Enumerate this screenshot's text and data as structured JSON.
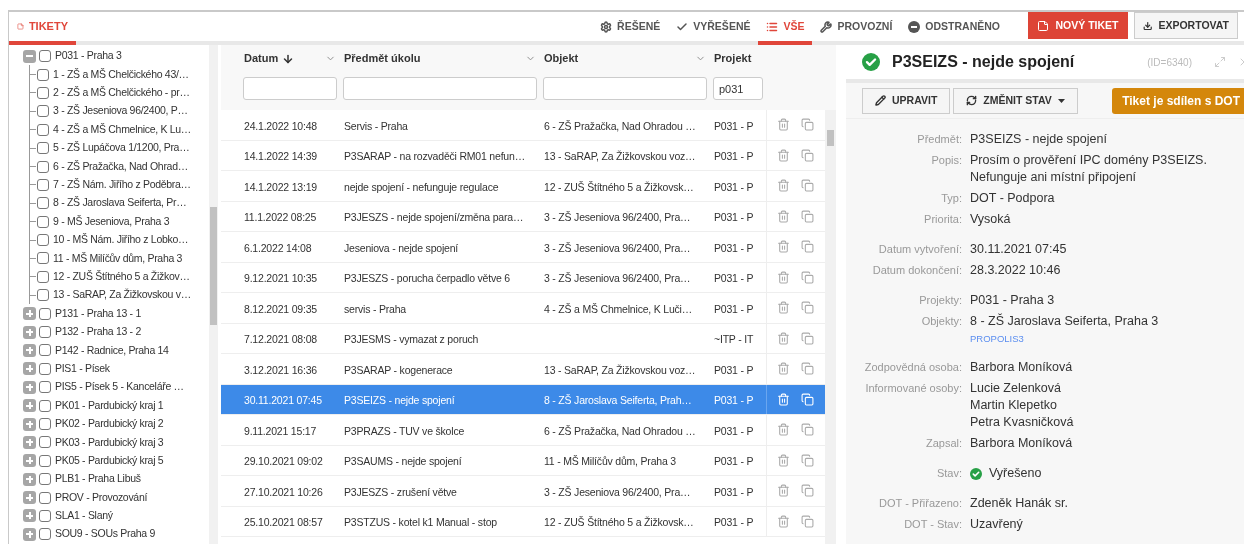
{
  "header": {
    "tab": {
      "label": "TIKETY",
      "selected": true
    },
    "filters": [
      {
        "label": "ŘEŠENÉ",
        "selected": false
      },
      {
        "label": "VYŘEŠENÉ",
        "selected": false
      },
      {
        "label": "VŠE",
        "selected": true
      },
      {
        "label": "PROVOZNÍ",
        "selected": false
      },
      {
        "label": "ODSTRANĚNO",
        "selected": false
      }
    ],
    "buttons": [
      {
        "label": "NOVÝ TIKET",
        "kind": "primary"
      },
      {
        "label": "EXPORTOVAT",
        "kind": "export"
      }
    ]
  },
  "tree": [
    {
      "label": "P031 - Praha 3",
      "expanded": true,
      "checked": false,
      "children": [
        {
          "label": "1 - ZŠ a MŠ Chelčického 43/…",
          "checked": false
        },
        {
          "label": "2 - ZŠ a MŠ Chelčického - pr…",
          "checked": false
        },
        {
          "label": "3 - ZŠ Jeseniova 96/2400, P…",
          "checked": false
        },
        {
          "label": "4 - ZŠ a MŠ Chmelnice, K Lu…",
          "checked": false
        },
        {
          "label": "5 - ZŠ Lupáčova 1/1200, Pra…",
          "checked": false
        },
        {
          "label": "6 - ZŠ Pražačka, Nad Ohrad…",
          "checked": false
        },
        {
          "label": "7 - ZŠ Nám. Jiřího z Poděbra…",
          "checked": false
        },
        {
          "label": "8 - ZŠ Jaroslava Seiferta, Pr…",
          "checked": false
        },
        {
          "label": "9 - MŠ Jeseniova, Praha 3",
          "checked": false
        },
        {
          "label": "10 - MŠ Nám. Jiřího z Lobko…",
          "checked": false
        },
        {
          "label": "11 - MŠ Milíčův dům, Praha 3",
          "checked": false
        },
        {
          "label": "12 - ZUŠ Štítného 5 a Žižkov…",
          "checked": false
        },
        {
          "label": "13 - SaRAP, Za Žižkovskou v…",
          "checked": false
        }
      ]
    },
    {
      "label": "P131 - Praha 13 - 1",
      "expanded": false,
      "checked": false
    },
    {
      "label": "P132 - Praha 13 - 2",
      "expanded": false,
      "checked": false
    },
    {
      "label": "P142 - Radnice, Praha 14",
      "expanded": false,
      "checked": false
    },
    {
      "label": "PIS1 - Písek",
      "expanded": false,
      "checked": false
    },
    {
      "label": "PIS5 - Písek 5 - Kanceláře …",
      "expanded": false,
      "checked": false
    },
    {
      "label": "PK01 - Pardubický kraj 1",
      "expanded": false,
      "checked": false
    },
    {
      "label": "PK02 - Pardubický kraj 2",
      "expanded": false,
      "checked": false
    },
    {
      "label": "PK03 - Pardubický kraj 3",
      "expanded": false,
      "checked": false
    },
    {
      "label": "PK05 - Pardubický kraj 5",
      "expanded": false,
      "checked": false
    },
    {
      "label": "PLB1 - Praha Libuš",
      "expanded": false,
      "checked": false
    },
    {
      "label": "PROV - Provozování",
      "expanded": false,
      "checked": false
    },
    {
      "label": "SLA1 - Slaný",
      "expanded": false,
      "checked": false
    },
    {
      "label": "SOU9 - SOUs Praha 9",
      "expanded": false,
      "checked": false
    }
  ],
  "table": {
    "columns": [
      {
        "label": "Datum",
        "sorted": true
      },
      {
        "label": "Předmět úkolu",
        "sorted": false
      },
      {
        "label": "Objekt",
        "sorted": false
      },
      {
        "label": "Projekt",
        "sorted": false,
        "filter_value": "p031"
      }
    ],
    "rows": [
      {
        "cells": [
          "24.1.2022 10:48",
          "Servis - Praha",
          "6 - ZŠ Pražačka, Nad Ohradou …",
          "P031 - P"
        ],
        "selected": false
      },
      {
        "cells": [
          "14.1.2022 14:39",
          "P3SARAP - na rozvaděči RM01 nefun…",
          "13 - SaRAP, Za Žižkovskou voz…",
          "P031 - P"
        ],
        "selected": false
      },
      {
        "cells": [
          "14.1.2022 13:19",
          "nejde spojení - nefunguje regulace",
          "12 - ZUŠ Štítného 5 a Žižkovsk…",
          "P031 - P"
        ],
        "selected": false
      },
      {
        "cells": [
          "11.1.2022 08:25",
          "P3JESZS - nejde spojení/změna para…",
          "3 - ZŠ Jeseniova 96/2400, Pra…",
          "P031 - P"
        ],
        "selected": false
      },
      {
        "cells": [
          "6.1.2022 14:08",
          "Jeseniova - nejde spojení",
          "3 - ZŠ Jeseniova 96/2400, Pra…",
          "P031 - P"
        ],
        "selected": false
      },
      {
        "cells": [
          "9.12.2021 10:35",
          "P3JESZS - porucha čerpadlo větve 6",
          "3 - ZŠ Jeseniova 96/2400, Pra…",
          "P031 - P"
        ],
        "selected": false
      },
      {
        "cells": [
          "8.12.2021 09:35",
          "servis - Praha",
          "4 - ZŠ a MŠ Chmelnice, K Luči…",
          "P031 - P"
        ],
        "selected": false
      },
      {
        "cells": [
          "7.12.2021 08:08",
          "P3JESMS - vymazat z poruch",
          "",
          "~ITP - IT"
        ],
        "selected": false
      },
      {
        "cells": [
          "3.12.2021 16:36",
          "P3SARAP - kogenerace",
          "13 - SaRAP, Za Žižkovskou voz…",
          "P031 - P"
        ],
        "selected": false
      },
      {
        "cells": [
          "30.11.2021 07:45",
          "P3SEIZS - nejde spojení",
          "8 - ZŠ Jaroslava Seiferta, Prah…",
          "P031 - P"
        ],
        "selected": true
      },
      {
        "cells": [
          "9.11.2021 15:17",
          "P3PRAZS - TUV ve školce",
          "6 - ZŠ Pražačka, Nad Ohradou …",
          "P031 - P"
        ],
        "selected": false
      },
      {
        "cells": [
          "29.10.2021 09:02",
          "P3SAUMS - nejde spojení",
          "11 - MŠ Milíčův dům, Praha 3",
          "P031 - P"
        ],
        "selected": false
      },
      {
        "cells": [
          "27.10.2021 10:26",
          "P3JESZS - zrušení větve",
          "3 - ZŠ Jeseniova 96/2400, Pra…",
          "P031 - P"
        ],
        "selected": false
      },
      {
        "cells": [
          "25.10.2021 08:57",
          "P3STZUS - kotel k1 Manual - stop",
          "12 - ZUŠ Štítného 5 a Žižkovsk…",
          "P031 - P"
        ],
        "selected": false
      }
    ]
  },
  "detail": {
    "title": "P3SEIZS - nejde spojení",
    "resolved": true,
    "id": "(ID=6340)",
    "buttons": [
      {
        "label": "UPRAVIT",
        "kind": "edit"
      },
      {
        "label": "ZMĚNIT STAV",
        "kind": "dropdown"
      }
    ],
    "badge": "Tiket je sdílen s DOT",
    "groups": [
      [
        {
          "label": "Předmět:",
          "values": [
            "P3SEIZS - nejde spojení"
          ]
        },
        {
          "label": "Popis:",
          "values": [
            "Prosím o prověření IPC domény P3SEIZS. Nefunguje ani místní připojení"
          ]
        },
        {
          "label": "Typ:",
          "values": [
            "DOT - Podpora"
          ]
        },
        {
          "label": "Priorita:",
          "values": [
            "Vysoká"
          ]
        }
      ],
      [
        {
          "label": "Datum vytvoření:",
          "values": [
            "30.11.2021 07:45"
          ]
        },
        {
          "label": "Datum dokončení:",
          "values": [
            "28.3.2022 10:46"
          ]
        }
      ],
      [
        {
          "label": "Projekty:",
          "values": [
            "P031 - Praha 3"
          ]
        },
        {
          "label": "Objekty:",
          "values": [
            "8 - ZŠ Jaroslava Seiferta, Praha 3"
          ],
          "link": "PROPOLIS3"
        }
      ],
      [
        {
          "label": "Zodpovědná osoba:",
          "values": [
            "Barbora Moníková"
          ]
        },
        {
          "label": "Informované osoby:",
          "values": [
            "Lucie Zelenková",
            "Martin Klepetko",
            "Petra Kvasničková"
          ]
        },
        {
          "label": "Zapsal:",
          "values": [
            "Barbora Moníková"
          ]
        }
      ],
      [
        {
          "label": "Stav:",
          "values": [
            "Vyřešeno"
          ],
          "kind": "status"
        }
      ],
      [
        {
          "label": "DOT - Přiřazeno:",
          "values": [
            "Zdeněk Hanák sr."
          ]
        },
        {
          "label": "DOT - Stav:",
          "values": [
            "Uzavřený"
          ]
        }
      ]
    ]
  }
}
